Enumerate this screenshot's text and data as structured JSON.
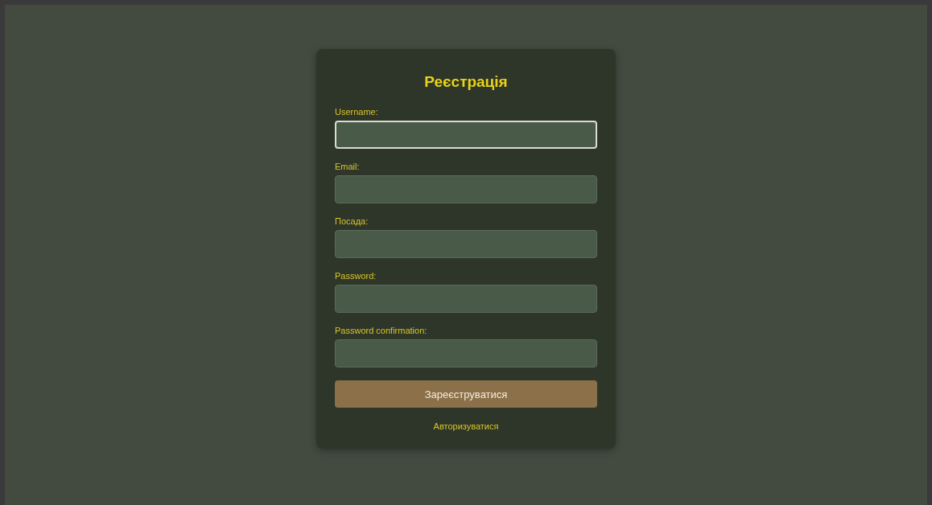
{
  "title": "Реєстрація",
  "fields": [
    {
      "label": "Username:",
      "focused": true
    },
    {
      "label": "Email:",
      "focused": false
    },
    {
      "label": "Посада:",
      "focused": false
    },
    {
      "label": "Password:",
      "focused": false
    },
    {
      "label": "Password confirmation:",
      "focused": false
    }
  ],
  "submit_button": "Зареєструватися",
  "login_link": "Авторизуватися"
}
